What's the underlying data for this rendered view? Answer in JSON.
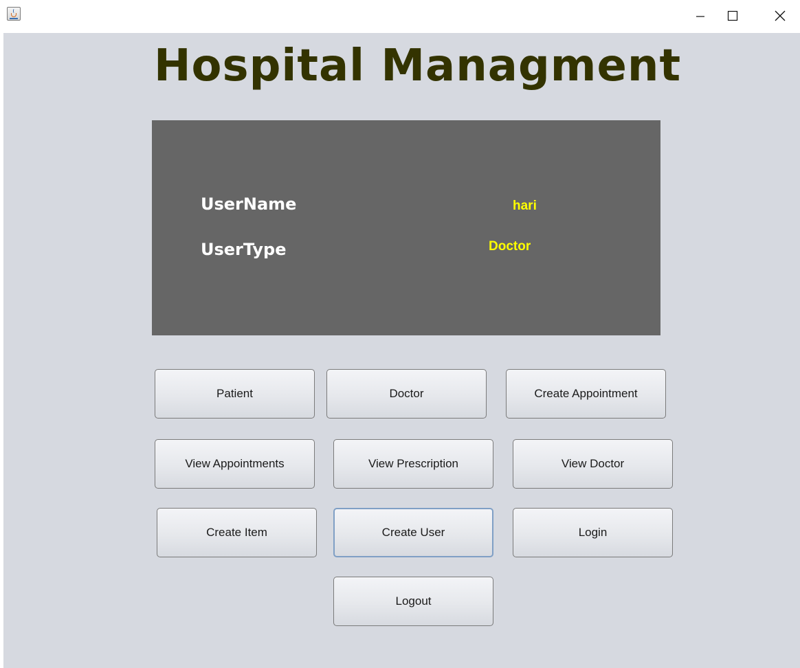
{
  "window": {
    "icon": "java-app-icon",
    "controls": {
      "minimize": "minimize-icon",
      "maximize": "maximize-icon",
      "close": "close-icon"
    }
  },
  "heading": "Hospital Managment",
  "user_panel": {
    "username_label": "UserName",
    "username_value": "hari",
    "usertype_label": "UserType",
    "usertype_value": "Doctor"
  },
  "buttons": {
    "patient": "Patient",
    "doctor": "Doctor",
    "create_appointment": "Create Appointment",
    "view_appointments": "View Appointments",
    "view_prescription": "View Prescription",
    "view_doctor": "View Doctor",
    "create_item": "Create Item",
    "create_user": "Create User",
    "login": "Login",
    "logout": "Logout"
  },
  "colors": {
    "background": "#d6d9e0",
    "heading": "#333300",
    "panel": "#666666",
    "panel_label": "#ffffff",
    "panel_value": "#ffff00"
  }
}
